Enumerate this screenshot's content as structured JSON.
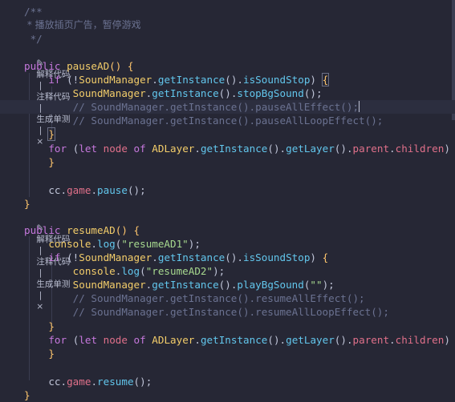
{
  "codelens": {
    "explain": "解释代码",
    "comment": "注释代码",
    "test": "生成单测",
    "close": "×"
  },
  "code": {
    "doc_open": "/**",
    "doc_text": " * 播放插页广告，暂停游戏",
    "doc_close": " */",
    "pause_fn": "pauseAD",
    "resume_fn": "resumeAD",
    "str_resume1": "\"resumeAD1\"",
    "str_resume2": "\"resumeAD2\"",
    "str_empty": "\"\"",
    "comment_pause_all": "// SoundManager.getInstance().pauseAllEffect();",
    "comment_pause_loop": "// SoundManager.getInstance().pauseAllLoopEffect();",
    "comment_resume_all": "// SoundManager.getInstance().resumeAllEffect();",
    "comment_resume_loop": "// SoundManager.getInstance().resumeAllLoopEffect();",
    "ellipsis": "…"
  }
}
